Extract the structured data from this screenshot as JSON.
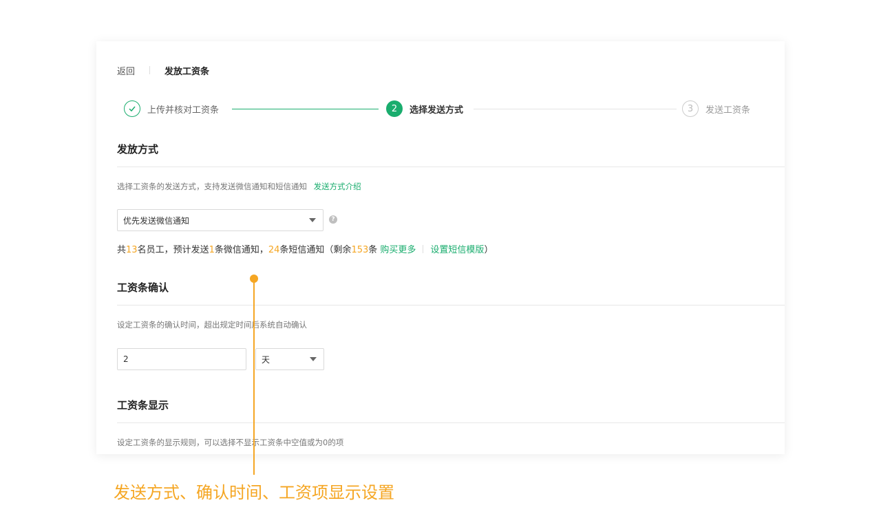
{
  "header": {
    "back_label": "返回",
    "title": "发放工资条"
  },
  "steps": [
    {
      "label": "上传并核对工资条",
      "state": "done"
    },
    {
      "number": "2",
      "label": "选择发送方式",
      "state": "active"
    },
    {
      "number": "3",
      "label": "发送工资条",
      "state": "todo"
    }
  ],
  "send_method": {
    "title": "发放方式",
    "description": "选择工资条的发送方式，支持发送微信通知和短信通知",
    "intro_link": "发送方式介绍",
    "select_value": "优先发送微信通知",
    "help_icon": "?",
    "summary": {
      "prefix": "共",
      "employees": "13",
      "mid1": "名员工，预计发送",
      "wechat": "1",
      "mid2": "条微信通知，",
      "sms": "24",
      "mid3": "条短信通知（剩余",
      "remaining": "153",
      "mid4": "条 ",
      "buy_more": "购买更多",
      "template_link": "设置短信模版",
      "suffix": "）"
    }
  },
  "confirm": {
    "title": "工资条确认",
    "description": "设定工资条的确认时间，超出规定时间后系统自动确认",
    "value": "2",
    "unit": "天"
  },
  "display": {
    "title": "工资条显示",
    "description": "设定工资条的显示规则，可以选择不显示工资条中空值或为0的项"
  },
  "callout": {
    "text": "发送方式、确认时间、工资项显示设置"
  },
  "colors": {
    "accent": "#1aad6e",
    "highlight": "#f5a623"
  }
}
